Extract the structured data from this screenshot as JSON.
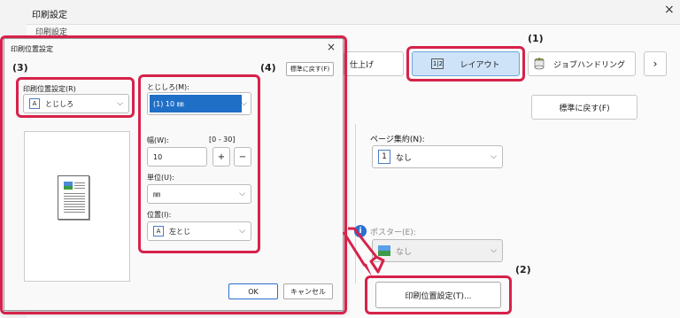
{
  "window": {
    "title": "印刷設定",
    "close": "×",
    "tab_strip_label": "印刷設定"
  },
  "tabs": {
    "finish": "仕上げ",
    "layout": "レイアウト",
    "layout_icon": "1|2",
    "job": "ジョブハンドリング",
    "next": "›"
  },
  "main": {
    "restore_defaults": "標準に戻す(F)",
    "page_summary_label": "ページ集約(N):",
    "page_summary_value": "なし",
    "page_summary_icon": "1",
    "poster_label": "ポスター(E):",
    "poster_value": "なし",
    "print_position_button": "印刷位置設定(T)..."
  },
  "dialog": {
    "title": "印刷位置設定",
    "close": "×",
    "restore_defaults": "標準に戻す(F)",
    "position_setting_label": "印刷位置設定(R)",
    "position_setting_value": "とじしろ",
    "binding_label": "とじしろ(M):",
    "binding_value": "(1) 10 ㎜",
    "width_label": "幅(W):",
    "width_range": "[0 - 30]",
    "width_value": "10",
    "plus": "+",
    "minus": "−",
    "unit_label": "単位(U):",
    "unit_value": "㎜",
    "position_label": "位置(I):",
    "position_value": "左とじ",
    "ok": "OK",
    "cancel": "キャンセル"
  },
  "callouts": {
    "c1": "(1)",
    "c2": "(2)",
    "c3": "(3)",
    "c4": "(4)"
  },
  "colors": {
    "callout_red": "#d6224a",
    "accent_blue": "#1f6fc6"
  }
}
